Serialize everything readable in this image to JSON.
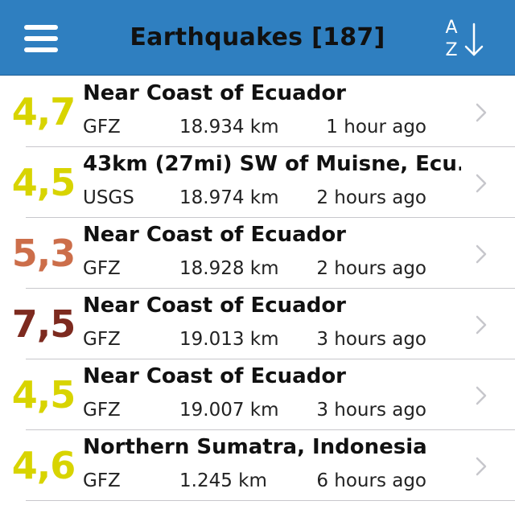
{
  "header": {
    "title": "Earthquakes [187]",
    "sort_top": "A",
    "sort_bottom": "Z",
    "menu_icon": "hamburger-menu-icon",
    "sort_icon": "sort-az-arrow-down-icon",
    "background": "#2f7fc0"
  },
  "colors": {
    "yellow": "#d8d400",
    "orange": "#cc6e4a",
    "darkred": "#7d2a1f",
    "chevron": "#c7c7cc"
  },
  "quakes": [
    {
      "magnitude": "4,7",
      "place": "Near Coast of Ecuador",
      "source": "GFZ",
      "distance": "18.934 km",
      "time": "1 hour ago",
      "color": "#d8d400"
    },
    {
      "magnitude": "4,5",
      "place": "43km (27mi) SW of Muisne, Ecu...",
      "source": "USGS",
      "distance": "18.974 km",
      "time": "2 hours ago",
      "color": "#d8d400"
    },
    {
      "magnitude": "5,3",
      "place": "Near Coast of Ecuador",
      "source": "GFZ",
      "distance": "18.928 km",
      "time": "2 hours ago",
      "color": "#cc6e4a"
    },
    {
      "magnitude": "7,5",
      "place": "Near Coast of Ecuador",
      "source": "GFZ",
      "distance": "19.013 km",
      "time": "3 hours ago",
      "color": "#7d2a1f"
    },
    {
      "magnitude": "4,5",
      "place": "Near Coast of Ecuador",
      "source": "GFZ",
      "distance": "19.007 km",
      "time": "3 hours ago",
      "color": "#d8d400"
    },
    {
      "magnitude": "4,6",
      "place": "Northern Sumatra, Indonesia",
      "source": "GFZ",
      "distance": "1.245 km",
      "time": "6 hours ago",
      "color": "#d8d400"
    }
  ]
}
